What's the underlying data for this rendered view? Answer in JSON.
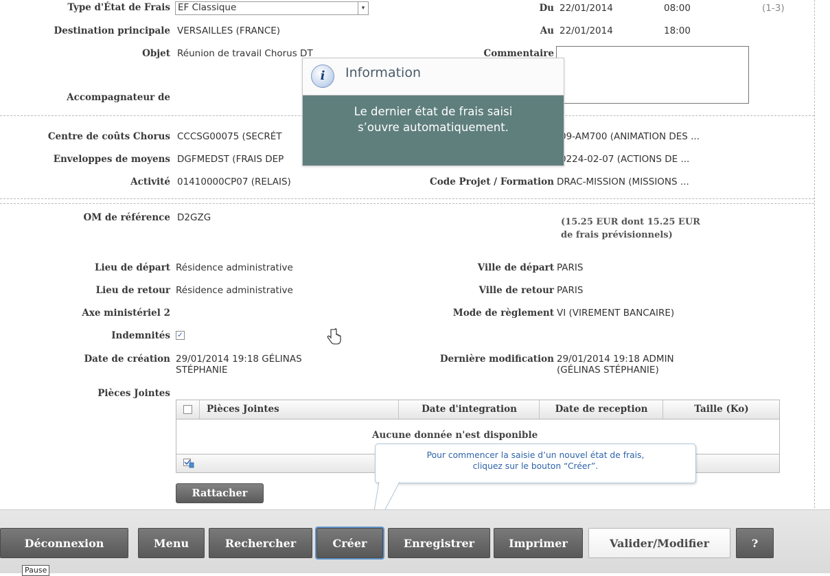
{
  "form": {
    "type_etat": {
      "label": "Type d'État de Frais",
      "value": "EF Classique"
    },
    "du": {
      "label": "Du",
      "date": "22/01/2014",
      "time": "08:00"
    },
    "extra_top_right": "(1-3)",
    "destination": {
      "label": "Destination principale",
      "value": "VERSAILLES (FRANCE)"
    },
    "au": {
      "label": "Au",
      "date": "22/01/2014",
      "time": "18:00"
    },
    "objet": {
      "label": "Objet",
      "value": "Réunion de travail Chorus DT"
    },
    "commentaire": {
      "label": "Commentaire",
      "value": ""
    },
    "accompagnateur": {
      "label": "Accompagnateur de",
      "value": ""
    },
    "centre_couts": {
      "label": "Centre de coûts Chorus",
      "value": "CCCSG00075 (SECRÉT"
    },
    "domaine_value": "09-AM700 (ANIMATION DES ...",
    "enveloppes": {
      "label": "Enveloppes de moyens",
      "value": "DGFMEDST (FRAIS DEP"
    },
    "enveloppes_right": "0224-02-07 (ACTIONS DE ...",
    "activite": {
      "label": "Activité",
      "value": "01410000CP07 (RELAIS)"
    },
    "code_projet": {
      "label": "Code Projet / Formation",
      "value": "DRAC-MISSION (MISSIONS ..."
    },
    "om_reference": {
      "label": "OM de référence",
      "value": "D2GZG"
    },
    "montant_line1": "(15.25 EUR dont 15.25 EUR",
    "montant_line2": "de frais prévisionnels)",
    "lieu_depart": {
      "label": "Lieu de départ",
      "value": "Résidence administrative"
    },
    "ville_depart": {
      "label": "Ville de départ",
      "value": "PARIS"
    },
    "lieu_retour": {
      "label": "Lieu de retour",
      "value": "Résidence administrative"
    },
    "ville_retour": {
      "label": "Ville de retour",
      "value": "PARIS"
    },
    "axe_ministeriel": {
      "label": "Axe ministériel 2",
      "value": ""
    },
    "mode_reglement": {
      "label": "Mode de règlement",
      "value": "VI (VIREMENT BANCAIRE)"
    },
    "indemnites": {
      "label": "Indemnités",
      "checked": true
    },
    "date_creation": {
      "label": "Date de création",
      "line1": "29/01/2014 19:18 GÉLINAS",
      "line2": "STÉPHANIE"
    },
    "derniere_modif": {
      "label": "Dernière modification",
      "line1": "29/01/2014 19:18 ADMIN",
      "line2": "(GÉLINAS STÉPHANIE)"
    },
    "pieces_jointes_label": "Pièces Jointes"
  },
  "grid": {
    "columns": [
      "Pièces Jointes",
      "Date d'integration",
      "Date de reception",
      "Taille (Ko)"
    ],
    "empty_message": "Aucune donnée n'est disponible"
  },
  "attach_button": "Rattacher",
  "info_tooltip": {
    "title": "Information",
    "line1": "Le dernier état de frais saisi",
    "line2": "s’ouvre automatiquement."
  },
  "callout": {
    "line1": "Pour commencer la saisie d’un nouvel état de frais,",
    "line2": "cliquez sur le bouton “Créer”."
  },
  "toolbar": {
    "deconnexion": "Déconnexion",
    "menu": "Menu",
    "rechercher": "Rechercher",
    "creer": "Créer",
    "enregistrer": "Enregistrer",
    "imprimer": "Imprimer",
    "valider": "Valider/Modifier",
    "help": "?"
  },
  "pause_label": "Pause"
}
